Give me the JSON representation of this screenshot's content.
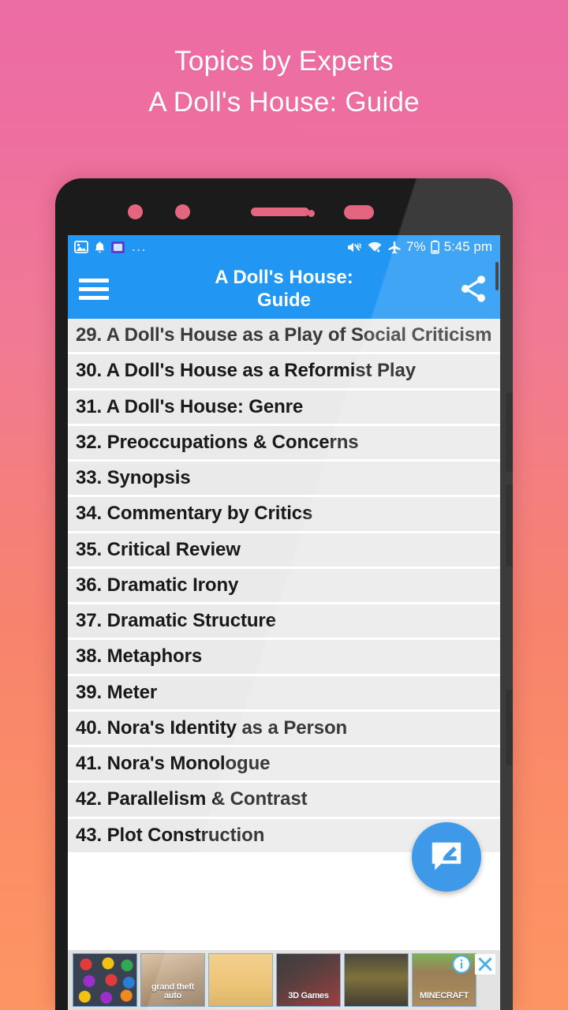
{
  "promo": {
    "line1": "Topics by Experts",
    "line2": "A Doll's House: Guide"
  },
  "theme": {
    "bg_top": "#ec6ca4",
    "bg_bottom": "#fd9563",
    "accent": "#2196f3",
    "fab": "#1e88e5",
    "item_bg": "#eaeaea"
  },
  "statusbar": {
    "left_icons": [
      "image-icon",
      "bell-icon",
      "app-notification-icon",
      "more-dots-icon"
    ],
    "dots": "...",
    "right_icons": [
      "mute-vibrate-icon",
      "wifi-icon",
      "airplane-mode-icon",
      "battery-icon"
    ],
    "battery_percent": "7%",
    "time": "5:45 pm"
  },
  "toolbar": {
    "menu_icon": "hamburger-menu-icon",
    "title_line1": "A Doll's House:",
    "title_line2": "Guide",
    "share_icon": "share-icon"
  },
  "list": {
    "items": [
      {
        "text": "29. A Doll's House as a Play of Social Criticism"
      },
      {
        "text": "30. A Doll's House as a Reformist Play"
      },
      {
        "text": "31. A Doll's House: Genre"
      },
      {
        "text": "32. Preoccupations & Concerns"
      },
      {
        "text": "33. Synopsis"
      },
      {
        "text": "34. Commentary by Critics"
      },
      {
        "text": "35. Critical Review"
      },
      {
        "text": "36. Dramatic Irony"
      },
      {
        "text": "37. Dramatic Structure"
      },
      {
        "text": "38. Metaphors"
      },
      {
        "text": "39. Meter"
      },
      {
        "text": "40. Nora's Identity as a Person"
      },
      {
        "text": "41. Nora's Monologue"
      },
      {
        "text": "42. Parallelism & Contrast"
      },
      {
        "text": "43. Plot Construction"
      }
    ]
  },
  "fab": {
    "icon": "feedback-comment-edit-icon"
  },
  "ad": {
    "thumbnails": [
      {
        "name": "candy-crush-ad-thumbnail",
        "label": ""
      },
      {
        "name": "grand-theft-auto-ad-thumbnail",
        "label": "grand theft auto"
      },
      {
        "name": "wheres-my-water-ad-thumbnail",
        "label": ""
      },
      {
        "name": "fruit-ninja-ad-thumbnail",
        "label": "3D Games"
      },
      {
        "name": "temple-run-ad-thumbnail",
        "label": ""
      },
      {
        "name": "minecraft-ad-thumbnail",
        "label": "MINECRAFT"
      }
    ],
    "info_icon": "ad-info-icon",
    "close_icon": "ad-close-icon"
  }
}
